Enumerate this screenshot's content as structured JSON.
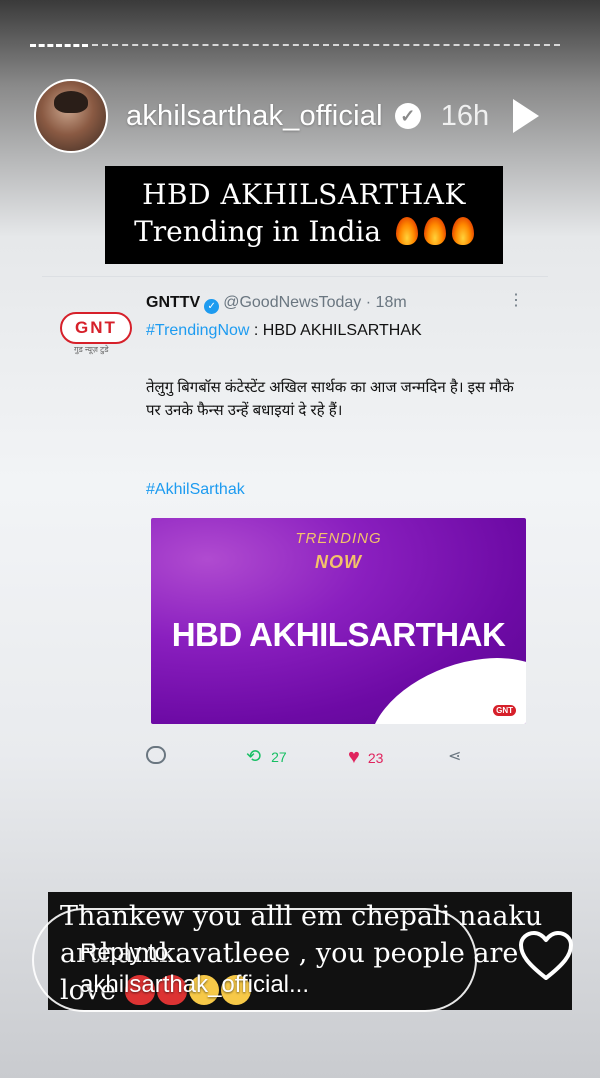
{
  "header": {
    "username": "akhilsarthak_official",
    "verified_icon": "verified-icon",
    "time_ago": "16h",
    "play_icon": "play-icon"
  },
  "banner": {
    "line1": "HBD AKHILSARTHAK",
    "line2": "Trending in India"
  },
  "tweet": {
    "logo_text": "GNT",
    "logo_sub": "गुड न्यूज़ टुडे",
    "display_name": "GNTTV",
    "handle": "@GoodNewsToday",
    "age": "· 18m",
    "more": "⋮",
    "hashtag_head": "#TrendingNow",
    "head_rest": " : HBD AKHILSARTHAK",
    "body": "तेलुगु बिगबॉस कंटेस्टेंट अखिल सार्थक का आज जन्मदिन है। इस मौके पर उनके फैन्स उन्हें बधाइयां दे रहे हैं।",
    "hashtag": "#AkhilSarthak",
    "image": {
      "trending": "TRENDING",
      "now": "NOW",
      "headline": "HBD AKHILSARTHAK",
      "mini_logo": "GNT"
    },
    "retweets": "27",
    "likes": "23"
  },
  "caption": {
    "line1": "Thankew you alll em chepali naaku",
    "line2": "arthamkavatleee , you people are",
    "line3": "love"
  },
  "reply": {
    "line1": "Reply to",
    "line2": "akhilsarthak_official..."
  },
  "icons": [
    "verified-icon",
    "play-icon",
    "reply-icon",
    "retweet-icon",
    "heart-icon",
    "share-icon",
    "like-story-icon"
  ]
}
